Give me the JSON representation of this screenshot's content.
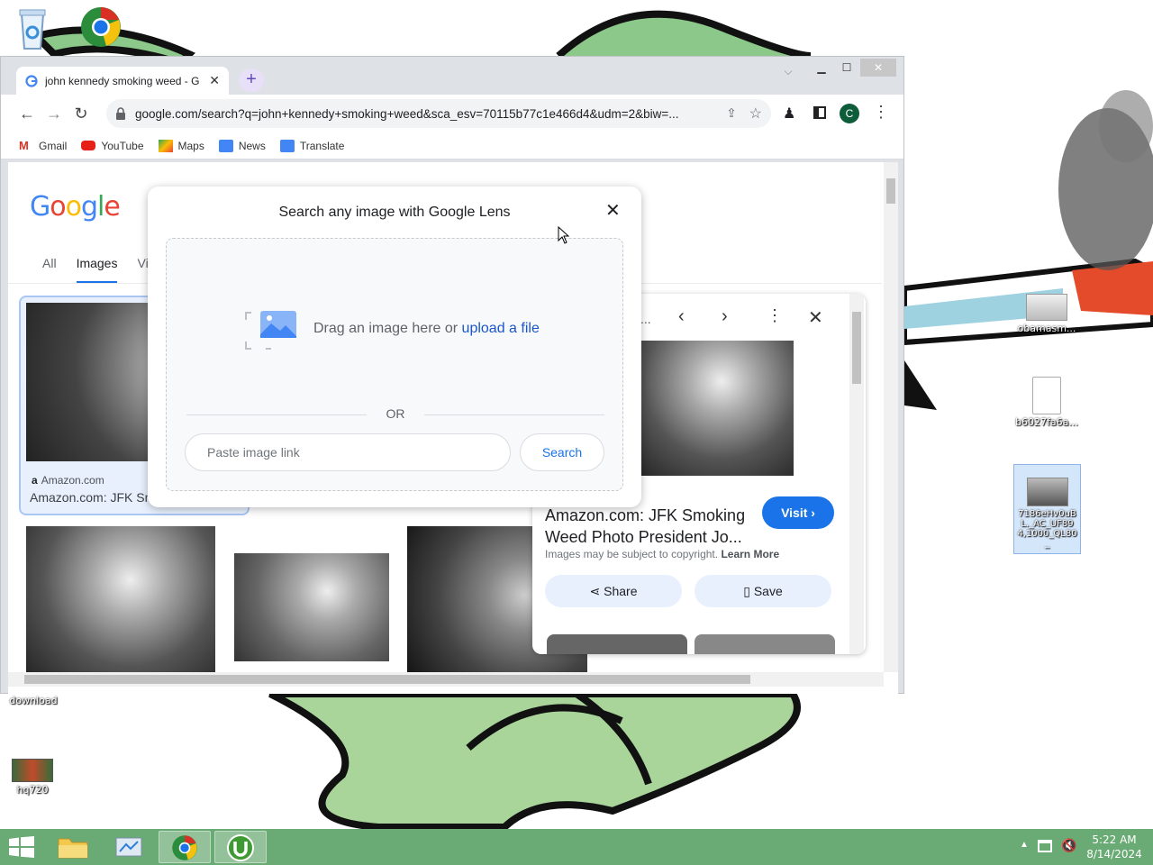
{
  "desktop": {
    "icons": [
      {
        "label": "obamasm..."
      },
      {
        "label": "b6027fa6a..."
      },
      {
        "label": "7186eHv0uBL._AC_UF894,1000_QL80_"
      },
      {
        "label": "download"
      },
      {
        "label": "hq720"
      }
    ]
  },
  "browser": {
    "tab_title": "john kennedy smoking weed - G",
    "new_tab_label": "+",
    "url": "google.com/search?q=john+kennedy+smoking+weed&sca_esv=70115b77c1e466d4&udm=2&biw=...",
    "profile_initial": "C",
    "bookmarks": [
      "Gmail",
      "YouTube",
      "Maps",
      "News",
      "Translate"
    ]
  },
  "google": {
    "logo": "Google",
    "tabs": [
      "All",
      "Images",
      "Vi"
    ],
    "active_tab": "Images",
    "result1_source": "Amazon.com",
    "result1_title": "Amazon.com: JFK Sm"
  },
  "side_panel": {
    "header_text": "...",
    "title": "Amazon.com: JFK Smoking Weed Photo President Jo...",
    "visit_label": "Visit",
    "copyright_text": "Images may be subject to copyright.",
    "learn_more": "Learn More",
    "share_label": "Share",
    "save_label": "Save"
  },
  "lens_dialog": {
    "title": "Search any image with Google Lens",
    "drag_text": "Drag an image here or",
    "upload_link": "upload a file",
    "or_text": "OR",
    "paste_placeholder": "Paste image link",
    "search_label": "Search"
  },
  "taskbar": {
    "time": "5:22 AM",
    "date": "8/14/2024"
  },
  "colors": {
    "taskbar": "#6aaa74",
    "accent": "#1a73e8",
    "wallpaper": "#ffffff"
  }
}
